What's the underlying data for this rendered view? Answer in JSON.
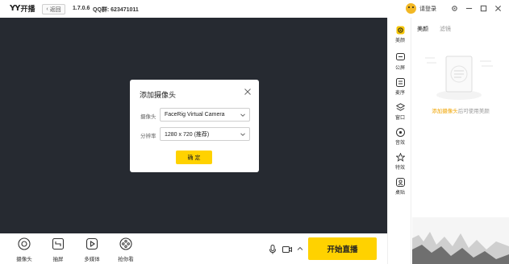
{
  "app": {
    "logo_text": "YY",
    "logo_name": "开播",
    "back_label": "返回",
    "version": "1.7.0.6",
    "qq": "QQ群: 623471011",
    "login_label": "请登录"
  },
  "dialog": {
    "title": "添加摄像头",
    "camera_label": "摄像头",
    "camera_value": "FaceRig Virtual Camera",
    "resolution_label": "分辨率",
    "resolution_value": "1280 x 720 (推荐)",
    "ok_label": "确 定"
  },
  "toolbar": {
    "tools": [
      {
        "label": "摄像头",
        "icon": "camera-circle-icon"
      },
      {
        "label": "抽屏",
        "icon": "screen-capture-icon"
      },
      {
        "label": "多媒体",
        "icon": "media-play-icon"
      },
      {
        "label": "抢你看",
        "icon": "gamepad-icon"
      }
    ],
    "start_label": "开始直播"
  },
  "sidebar": {
    "items": [
      {
        "label": "美颜",
        "icon": "beauty-icon",
        "active": true
      },
      {
        "label": "公屏",
        "icon": "chat-icon"
      },
      {
        "label": "麦序",
        "icon": "list-icon"
      },
      {
        "label": "窗口",
        "icon": "layers-icon"
      },
      {
        "label": "音效",
        "icon": "sound-icon"
      },
      {
        "label": "特效",
        "icon": "star-icon"
      },
      {
        "label": "桌贴",
        "icon": "sticker-icon"
      }
    ]
  },
  "panel": {
    "tabs": [
      "美颜",
      "滤镜"
    ],
    "empty_link": "添加摄像头",
    "empty_text": "后可使用美颜"
  },
  "colors": {
    "accent": "#ffd200",
    "preview_bg": "#262a31",
    "link": "#f0a400"
  }
}
